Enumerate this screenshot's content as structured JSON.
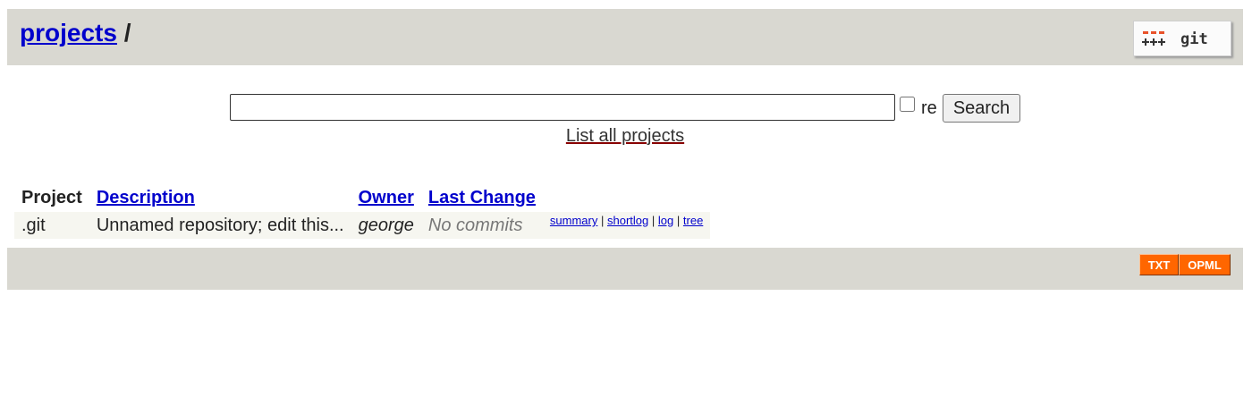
{
  "header": {
    "breadcrumb_link": "projects",
    "breadcrumb_separator": "/",
    "logo_text": "git"
  },
  "search": {
    "input_value": "",
    "regex_label": "re",
    "regex_checked": false,
    "button_label": "Search",
    "list_all_link": "List all projects"
  },
  "table": {
    "headers": {
      "project": "Project",
      "description": "Description",
      "owner": "Owner",
      "last_change": "Last Change"
    },
    "rows": [
      {
        "project": ".git",
        "description": "Unnamed repository; edit this...",
        "owner": "george",
        "last_change": "No commits",
        "links": {
          "summary": "summary",
          "shortlog": "shortlog",
          "log": "log",
          "tree": "tree",
          "separator": "|"
        }
      }
    ]
  },
  "footer": {
    "txt_label": "TXT",
    "opml_label": "OPML"
  },
  "colors": {
    "header_bg": "#d9d8d1",
    "link": "#0000cc",
    "feed_orange": "#ff6600",
    "row_bg": "#f6f6f0"
  }
}
